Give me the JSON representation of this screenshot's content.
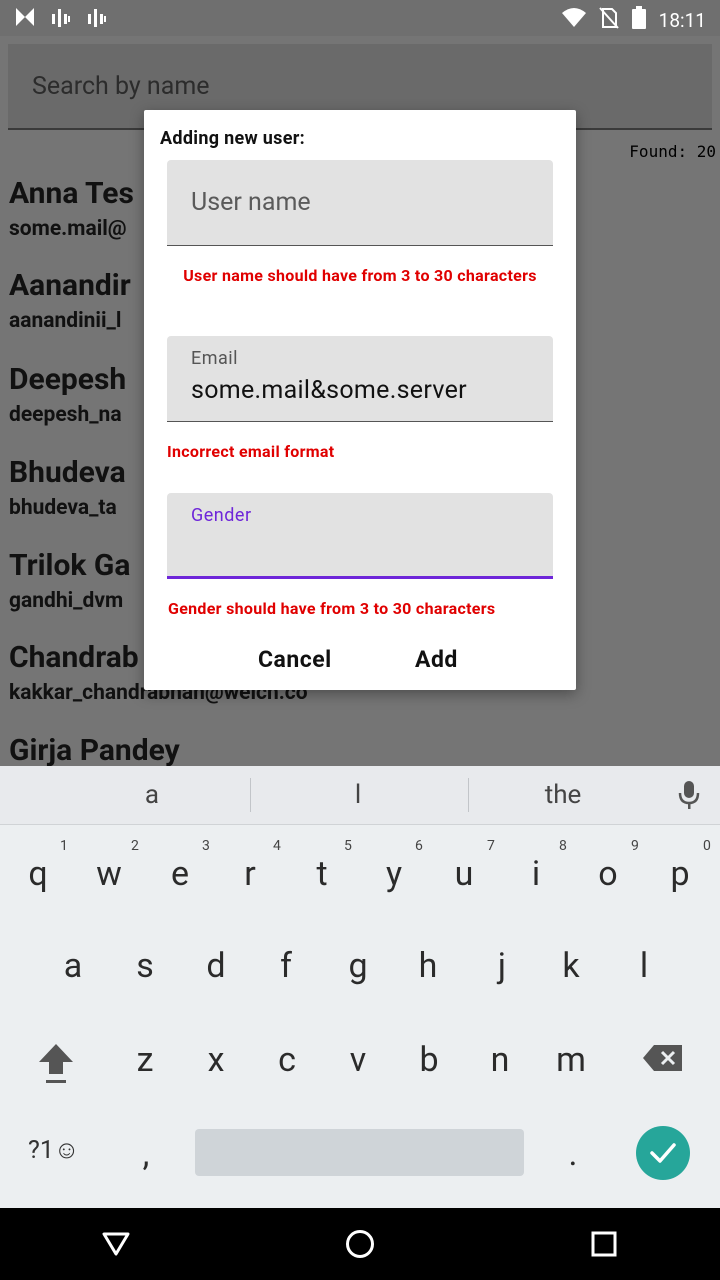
{
  "status_bar": {
    "time": "18:11",
    "icons": [
      "n-icon",
      "signal-icon",
      "signal-icon",
      "wifi-icon",
      "no-sim-icon",
      "battery-icon"
    ]
  },
  "app": {
    "search_placeholder": "Search by name",
    "found_label": "Found: 20",
    "users": [
      {
        "name": "Anna Tes",
        "email": "some.mail@"
      },
      {
        "name": "Aanandir",
        "email": "aanandinii_l"
      },
      {
        "name": "Deepesh",
        "email": "deepesh_na"
      },
      {
        "name": "Bhudeva",
        "email": "bhudeva_ta"
      },
      {
        "name": "Trilok Ga",
        "email": "gandhi_dvm"
      },
      {
        "name": "Chandrab",
        "email": "kakkar_chandrabhan@welch.co"
      },
      {
        "name": "Girja Pandey",
        "email": ""
      }
    ]
  },
  "dialog": {
    "title": "Adding new user:",
    "username": {
      "placeholder": "User name",
      "value": "",
      "error": "User name should have from 3 to 30 characters"
    },
    "email": {
      "label": "Email",
      "value": "some.mail&some.server",
      "error": "Incorrect email format"
    },
    "gender": {
      "label": "Gender",
      "value": "",
      "error": "Gender should have from 3 to 30 characters"
    },
    "cancel_label": "Cancel",
    "add_label": "Add"
  },
  "keyboard": {
    "suggestions": [
      "a",
      "l",
      "the"
    ],
    "row1": [
      "q",
      "w",
      "e",
      "r",
      "t",
      "y",
      "u",
      "i",
      "o",
      "p"
    ],
    "row1_hints": [
      "1",
      "2",
      "3",
      "4",
      "5",
      "6",
      "7",
      "8",
      "9",
      "0"
    ],
    "row2": [
      "a",
      "s",
      "d",
      "f",
      "g",
      "h",
      "j",
      "k",
      "l"
    ],
    "row3": [
      "z",
      "x",
      "c",
      "v",
      "b",
      "n",
      "m"
    ],
    "symbols_label": "?1☺",
    "comma": ",",
    "period": ".",
    "accent_color": "#26a69a"
  },
  "colors": {
    "focus": "#6e26d9",
    "error": "#e00000"
  }
}
